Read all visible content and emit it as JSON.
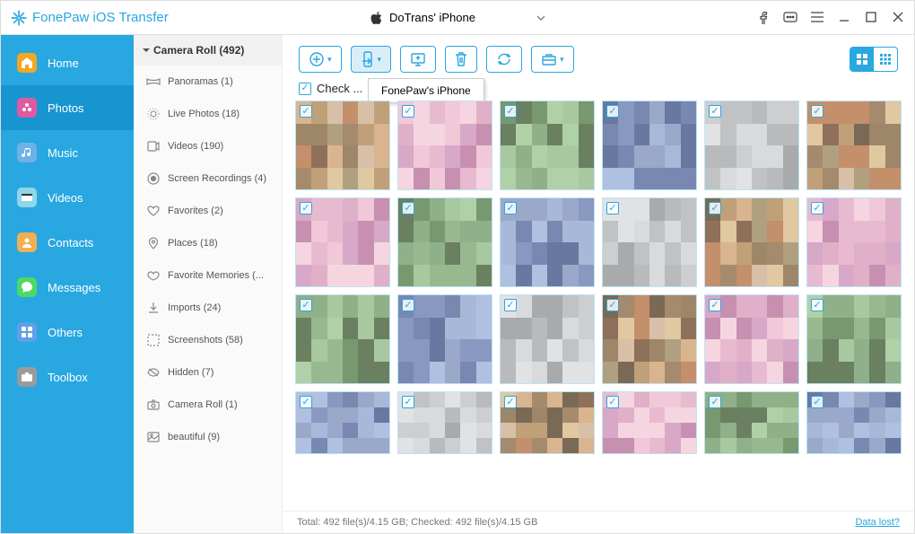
{
  "app_title": "FonePaw iOS Transfer",
  "device": {
    "name": "DoTrans' iPhone"
  },
  "tooltip": "FonePaw's iPhone",
  "sidebar": {
    "items": [
      {
        "label": "Home",
        "icon": "home-icon",
        "color": "#f5a623"
      },
      {
        "label": "Photos",
        "icon": "photos-icon",
        "color": "#e05aa0"
      },
      {
        "label": "Music",
        "icon": "music-icon",
        "color": "#6eb1e6"
      },
      {
        "label": "Videos",
        "icon": "videos-icon",
        "color": "#8fd6e8"
      },
      {
        "label": "Contacts",
        "icon": "contacts-icon",
        "color": "#f0b050"
      },
      {
        "label": "Messages",
        "icon": "messages-icon",
        "color": "#4cd964"
      },
      {
        "label": "Others",
        "icon": "others-icon",
        "color": "#5fa0e8"
      },
      {
        "label": "Toolbox",
        "icon": "toolbox-icon",
        "color": "#9b9b9b"
      }
    ],
    "active_index": 1
  },
  "folder_pane": {
    "header": "Camera Roll (492)",
    "folders": [
      {
        "label": "Panoramas (1)",
        "icon": "panorama-icon"
      },
      {
        "label": "Live Photos (18)",
        "icon": "live-photos-icon"
      },
      {
        "label": "Videos (190)",
        "icon": "videos-folder-icon"
      },
      {
        "label": "Screen Recordings (4)",
        "icon": "screen-rec-icon"
      },
      {
        "label": "Favorites (2)",
        "icon": "heart-icon"
      },
      {
        "label": "Places (18)",
        "icon": "places-icon"
      },
      {
        "label": "Favorite Memories (...",
        "icon": "memories-icon"
      },
      {
        "label": "Imports (24)",
        "icon": "imports-icon"
      },
      {
        "label": "Screenshots (58)",
        "icon": "screenshots-icon"
      },
      {
        "label": "Hidden (7)",
        "icon": "hidden-icon"
      },
      {
        "label": "Camera Roll (1)",
        "icon": "camera-roll-icon"
      },
      {
        "label": "beautiful (9)",
        "icon": "album-icon"
      }
    ]
  },
  "toolbar": {
    "buttons": [
      {
        "name": "add-button",
        "icon": "plus-circle-icon",
        "caret": true
      },
      {
        "name": "export-button",
        "icon": "export-phone-icon",
        "caret": true,
        "active": true
      },
      {
        "name": "to-pc-button",
        "icon": "to-pc-icon"
      },
      {
        "name": "delete-button",
        "icon": "trash-icon"
      },
      {
        "name": "refresh-button",
        "icon": "refresh-icon"
      },
      {
        "name": "toolbox-button",
        "icon": "briefcase-icon",
        "caret": true
      }
    ]
  },
  "check_all_label": "Check ...",
  "statusbar": {
    "totals": "Total: 492 file(s)/4.15 GB; Checked: 492 file(s)/4.15 GB",
    "link": "Data lost?"
  },
  "thumbnail_rows": 4,
  "thumbnails_per_row": 6
}
